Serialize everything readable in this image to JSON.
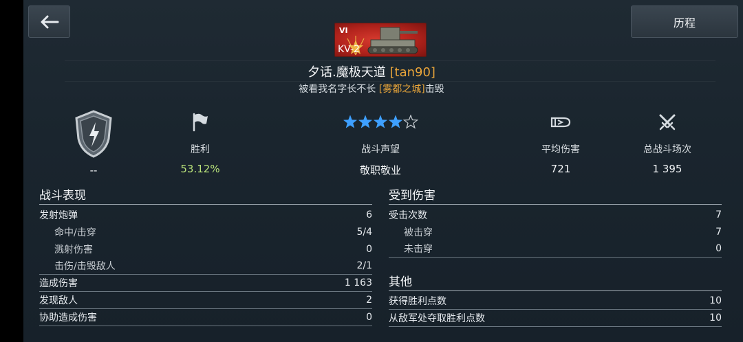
{
  "header": {
    "history_label": "历程"
  },
  "tank": {
    "tier": "VI",
    "name": "KV-2"
  },
  "player": {
    "name": "夕话.魔极天道",
    "clan": "[tan90]"
  },
  "killed_by": {
    "prefix": "被",
    "killer": "看我名字长不长",
    "clan": "[雾都之城]",
    "suffix": "击毁"
  },
  "stats": {
    "rating": {
      "value": "--"
    },
    "winrate": {
      "label": "胜利",
      "value": "53.12%"
    },
    "reputation": {
      "label": "战斗声望",
      "value": "敬职敬业",
      "stars": 4,
      "max_stars": 5
    },
    "avg_damage": {
      "label": "平均伤害",
      "value": "721"
    },
    "battles": {
      "label": "总战斗场次",
      "value": "1 395"
    }
  },
  "performance": {
    "title": "战斗表现",
    "rows": [
      {
        "label": "发射炮弹",
        "value": "6"
      },
      {
        "label": "命中/击穿",
        "value": "5/4"
      },
      {
        "label": "溅射伤害",
        "value": "0"
      },
      {
        "label": "击伤/击毁敌人",
        "value": "2/1"
      },
      {
        "label": "造成伤害",
        "value": "1 163"
      },
      {
        "label": "发现敌人",
        "value": "2"
      },
      {
        "label": "协助造成伤害",
        "value": "0"
      }
    ]
  },
  "damage_received": {
    "title": "受到伤害",
    "rows": [
      {
        "label": "受击次数",
        "value": "7"
      },
      {
        "label": "被击穿",
        "value": "7"
      },
      {
        "label": "未击穿",
        "value": "0"
      }
    ]
  },
  "other": {
    "title": "其他",
    "rows": [
      {
        "label": "获得胜利点数",
        "value": "10"
      },
      {
        "label": "从敌军处夺取胜利点数",
        "value": "10"
      }
    ]
  },
  "colors": {
    "accent_gold": "#e9a53a",
    "winrate_green": "#b9e27a",
    "star_blue": "#3ea0ff"
  }
}
